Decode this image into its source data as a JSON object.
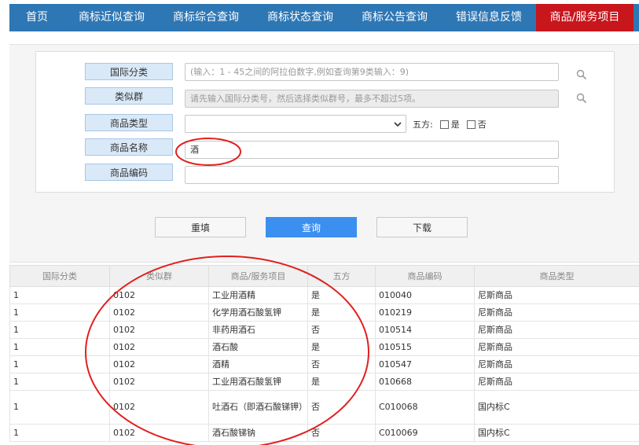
{
  "nav": {
    "items": [
      {
        "label": "首页",
        "active": false
      },
      {
        "label": "商标近似查询",
        "active": false
      },
      {
        "label": "商标综合查询",
        "active": false
      },
      {
        "label": "商标状态查询",
        "active": false
      },
      {
        "label": "商标公告查询",
        "active": false
      },
      {
        "label": "错误信息反馈",
        "active": false
      },
      {
        "label": "商品/服务项目",
        "active": true
      }
    ],
    "active_color": "#c8161d",
    "bar_color": "#2e77b5"
  },
  "form": {
    "intl_class_label": "国际分类",
    "intl_class_placeholder": "(输入：1 - 45之间的阿拉伯数字,例如查询第9类输入：9)",
    "similar_group_label": "类似群",
    "similar_group_placeholder": "请先输入国际分类号，然后选择类似群号，最多不超过5项。",
    "goods_type_label": "商品类型",
    "goods_type_value": "",
    "five_label": "五方:",
    "five_yes": "是",
    "five_no": "否",
    "goods_name_label": "商品名称",
    "goods_name_value": "酒",
    "goods_code_label": "商品编码",
    "goods_code_value": ""
  },
  "buttons": {
    "reset": "重填",
    "query": "查询",
    "download": "下载"
  },
  "table": {
    "headers": [
      "国际分类",
      "类似群",
      "商品/服务项目",
      "五方",
      "商品编码",
      "商品类型"
    ],
    "rows": [
      [
        "1",
        "0102",
        "工业用酒精",
        "是",
        "010040",
        "尼斯商品"
      ],
      [
        "1",
        "0102",
        "化学用酒石酸氢钾",
        "是",
        "010219",
        "尼斯商品"
      ],
      [
        "1",
        "0102",
        "非药用酒石",
        "否",
        "010514",
        "尼斯商品"
      ],
      [
        "1",
        "0102",
        "酒石酸",
        "是",
        "010515",
        "尼斯商品"
      ],
      [
        "1",
        "0102",
        "酒精",
        "否",
        "010547",
        "尼斯商品"
      ],
      [
        "1",
        "0102",
        "工业用酒石酸氢钾",
        "是",
        "010668",
        "尼斯商品"
      ],
      [
        "1",
        "0102",
        "吐酒石（即酒石酸锑钾）",
        "否",
        "C010068",
        "国内标C"
      ],
      [
        "1",
        "0102",
        "酒石酸锑钠",
        "否",
        "C010069",
        "国内标C"
      ]
    ]
  },
  "annotation_color": "#e0201e"
}
